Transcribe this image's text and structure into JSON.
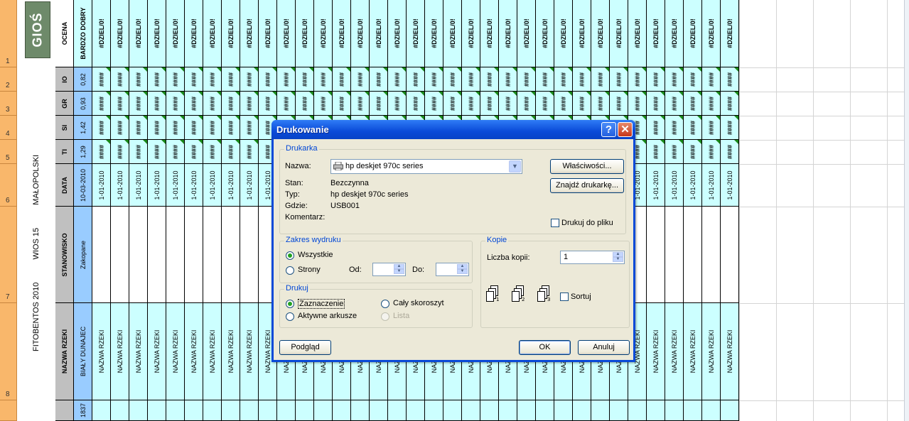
{
  "sheet": {
    "row_numbers": [
      "1",
      "2",
      "3",
      "4",
      "5",
      "6",
      "7",
      "8"
    ],
    "logo_text": "GIOŚ",
    "side_title_1": "FITOBENTOS 2010",
    "side_title_2": "WIOS 15",
    "side_title_3": "MAŁOPOLSKI",
    "labels": {
      "ocena": "OCENA",
      "io": "IO",
      "gr": "GR",
      "si": "SI",
      "ti": "TI",
      "data": "DATA",
      "stanowisko": "STANOWISKO",
      "nazwa_rzeki": "NAZWA RZEKI"
    },
    "values": {
      "ocena": "BARDZO DOBRY",
      "io": "0,82",
      "gr": "0,93",
      "si": "1,42",
      "ti": "1,29",
      "data": "10-03-2010",
      "stanowisko": "Zakopane",
      "nazwa_rzeki": "BIAŁY DUNAJEC",
      "row9": "1837"
    },
    "repeat": {
      "error": "#DZIEL/0!",
      "hashes": "####",
      "date": "1-01-2010",
      "river": "NAZWA RZEKI"
    }
  },
  "dialog": {
    "title": "Drukowanie",
    "help_symbol": "?",
    "close_symbol": "✕",
    "printer_group": "Drukarka",
    "name_label": "Nazwa:",
    "printer_name": "hp deskjet 970c series",
    "status_label": "Stan:",
    "status_value": "Bezczynna",
    "type_label": "Typ:",
    "type_value": "hp deskjet 970c series",
    "where_label": "Gdzie:",
    "where_value": "USB001",
    "comment_label": "Komentarz:",
    "properties_button": "Właściwości...",
    "find_printer_button": "Znajdź drukarkę...",
    "print_to_file": "Drukuj do pliku",
    "range_group": "Zakres wydruku",
    "range_all": "Wszystkie",
    "range_pages": "Strony",
    "from_label": "Od:",
    "to_label": "Do:",
    "print_group": "Drukuj",
    "print_selection": "Zaznaczenie",
    "print_active_sheets": "Aktywne arkusze",
    "print_workbook": "Cały skoroszyt",
    "print_list": "Lista",
    "copies_group": "Kopie",
    "copies_label": "Liczba kopii:",
    "copies_value": "1",
    "collate": "Sortuj",
    "preview_button": "Podgląd",
    "ok_button": "OK",
    "cancel_button": "Anuluj",
    "selected_range": "Wszystkie",
    "selected_print": "Zaznaczenie",
    "collate_checked": false,
    "print_to_file_checked": false
  }
}
